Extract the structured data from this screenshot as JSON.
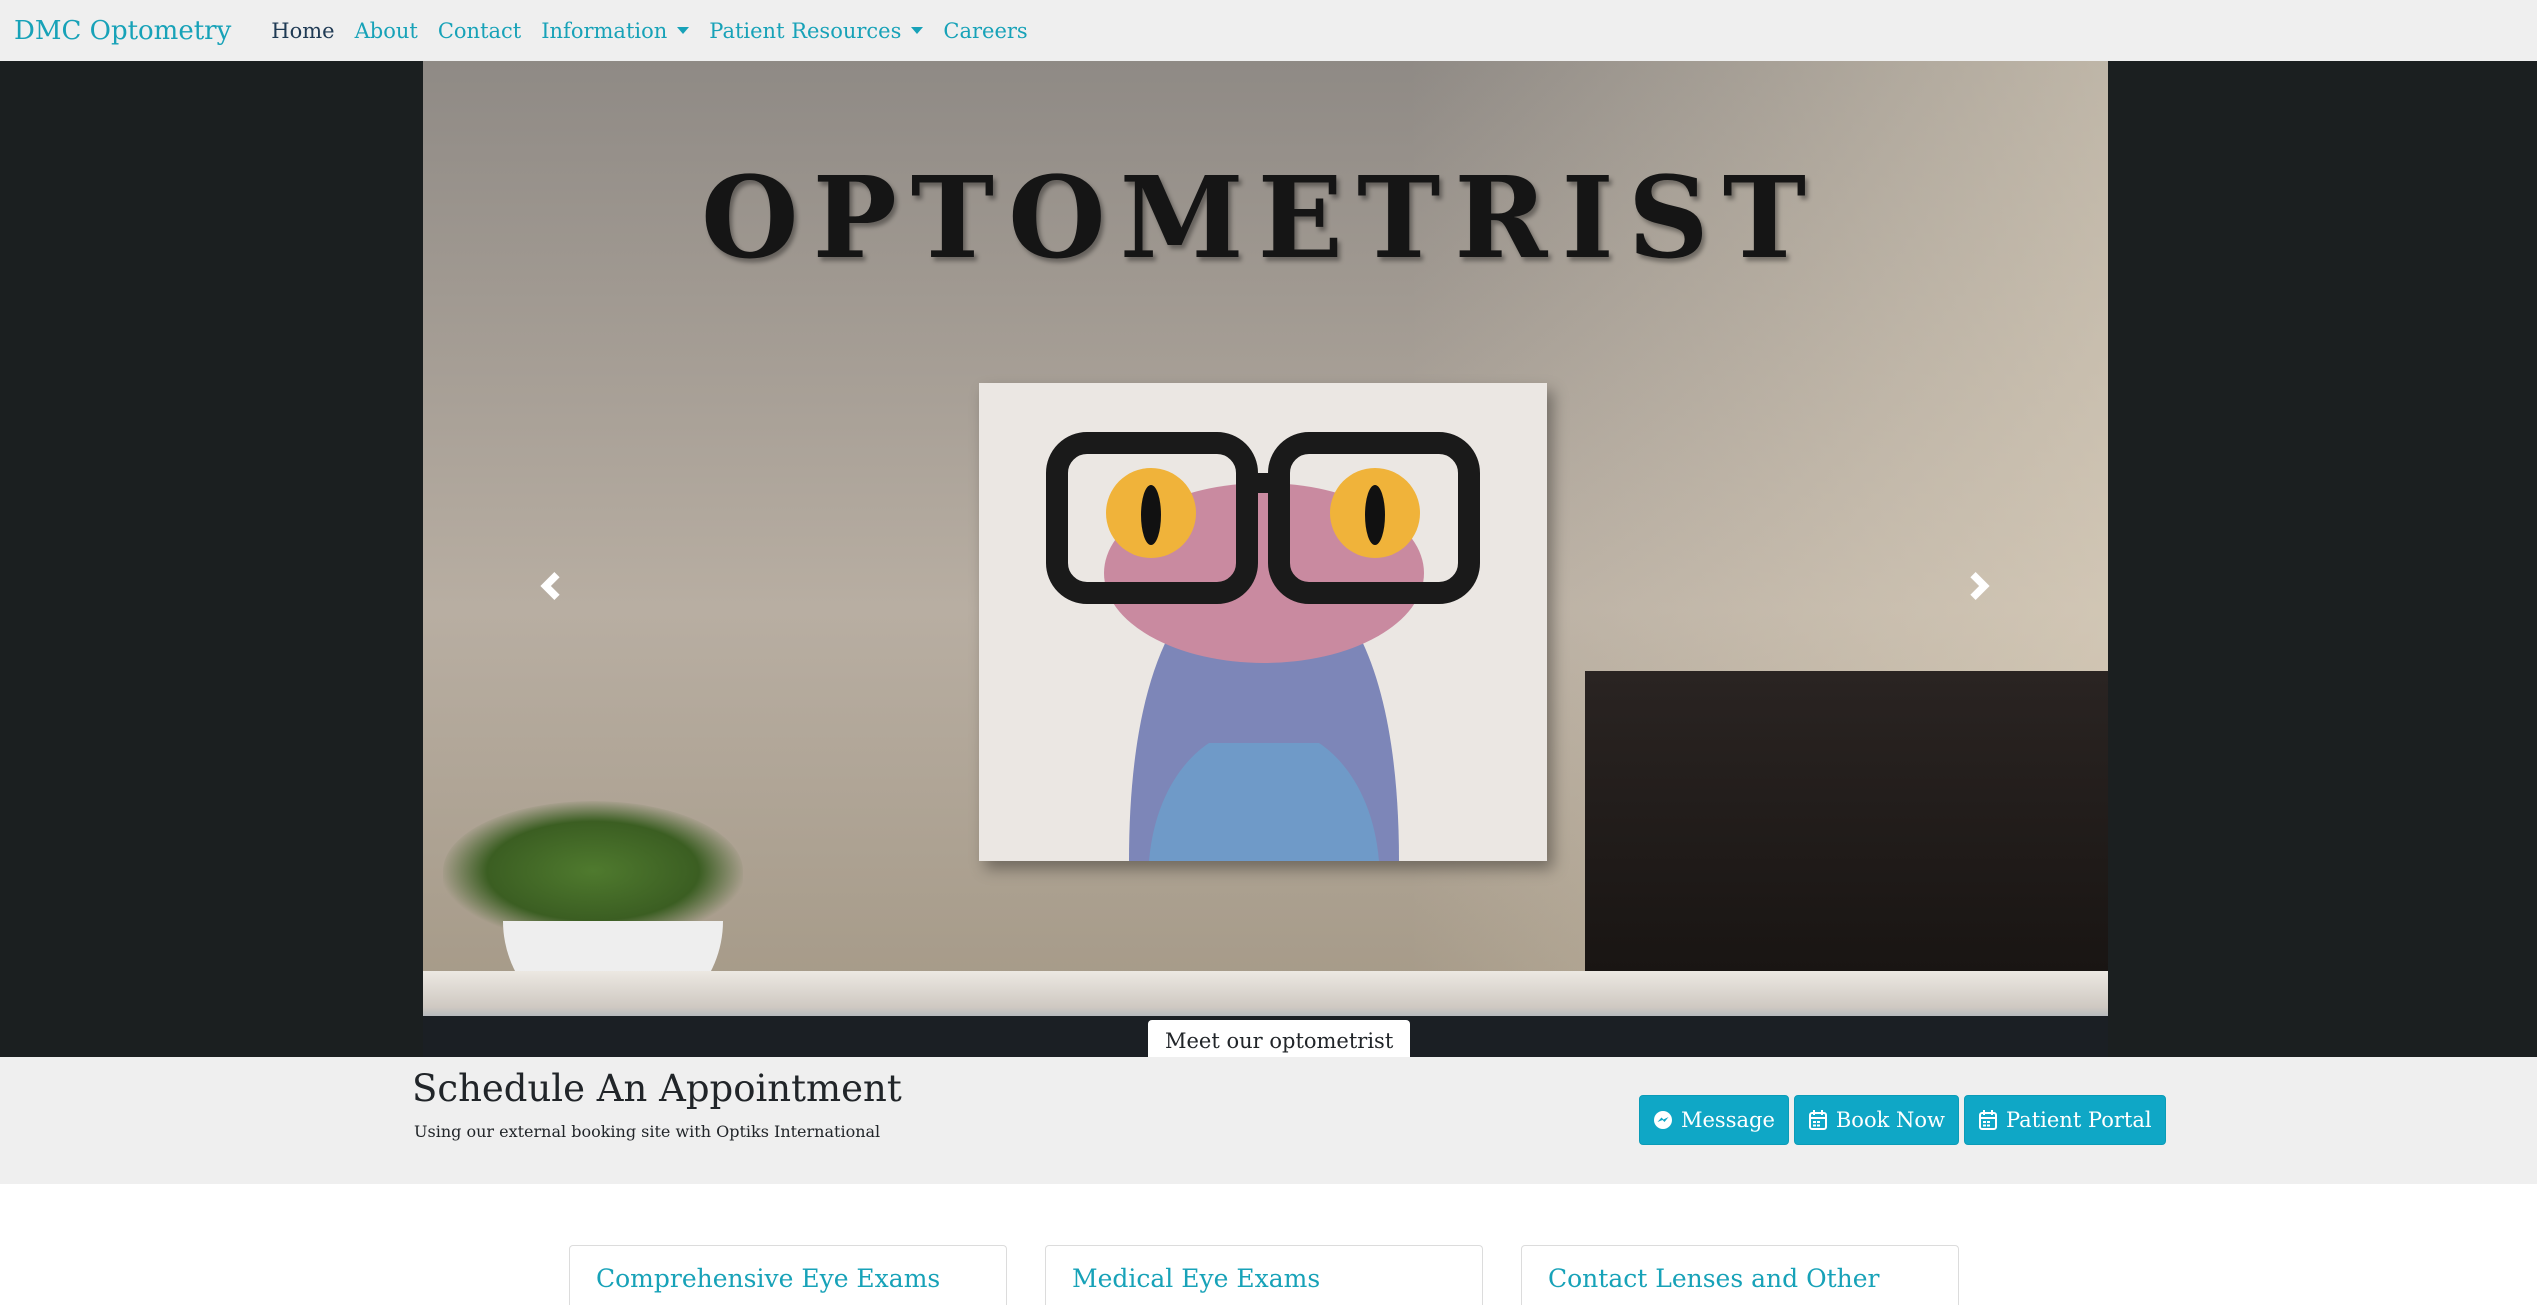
{
  "nav": {
    "brand": "DMC Optometry",
    "items": [
      {
        "label": "Home"
      },
      {
        "label": "About"
      },
      {
        "label": "Contact"
      },
      {
        "label": "Information"
      },
      {
        "label": "Patient Resources"
      },
      {
        "label": "Careers"
      }
    ]
  },
  "hero": {
    "sign_text": "OPTOMETRIST",
    "caption": "Meet our optometrist",
    "indicators": 2,
    "active_indicator": 1
  },
  "schedule": {
    "title": "Schedule An Appointment",
    "subtitle": "Using our external booking site with Optiks International",
    "buttons": [
      {
        "label": "Message",
        "icon": "messenger-icon"
      },
      {
        "label": "Book Now",
        "icon": "calendar-icon"
      },
      {
        "label": "Patient Portal",
        "icon": "calendar-icon"
      }
    ]
  },
  "cards": [
    {
      "title": "Comprehensive Eye Exams"
    },
    {
      "title": "Medical Eye Exams"
    },
    {
      "title": "Contact Lenses and Other"
    }
  ],
  "colors": {
    "accent": "#17a2b8",
    "button": "#0fa7c6",
    "dark": "#1b1f20"
  }
}
